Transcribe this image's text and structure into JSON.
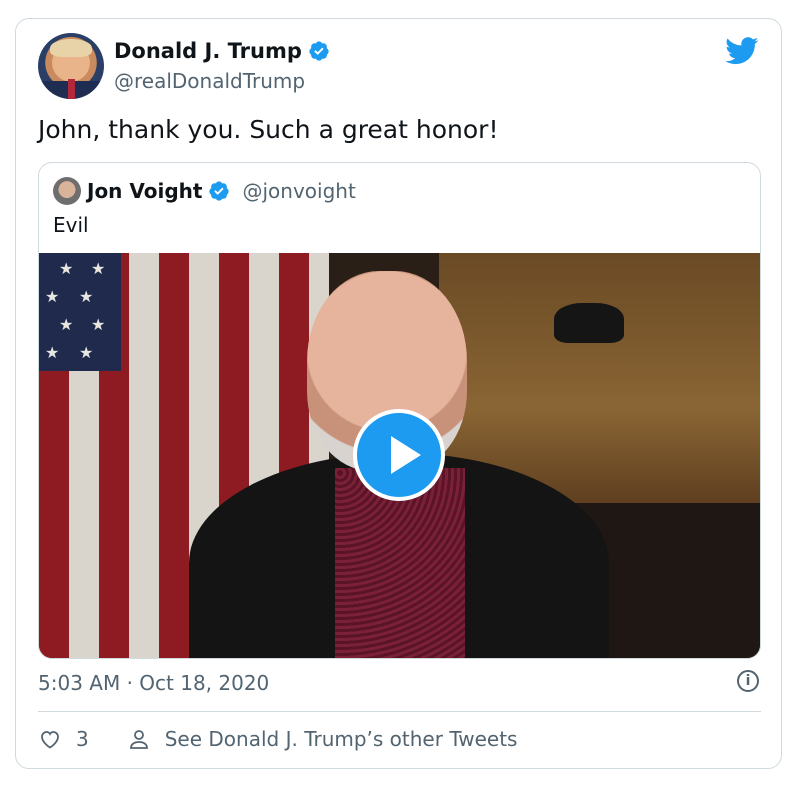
{
  "author": {
    "name": "Donald J. Trump",
    "handle": "@realDonaldTrump"
  },
  "tweet": {
    "text": "John, thank you. Such a great honor!",
    "timestamp": "5:03 AM · Oct 18, 2020",
    "like_count": "3",
    "other_tweets_label": "See Donald J. Trump’s other Tweets"
  },
  "quoted": {
    "name": "Jon Voight",
    "handle": "@jonvoight",
    "text": "Evil"
  },
  "icons": {
    "brand": "twitter-bird-icon",
    "verified": "verified-badge-icon",
    "play": "play-icon",
    "info": "info-icon",
    "like": "heart-icon",
    "profile": "person-icon"
  },
  "colors": {
    "accent": "#1d9bf0",
    "text": "#0f1419",
    "secondary": "#536471",
    "border": "#cfd9de"
  }
}
